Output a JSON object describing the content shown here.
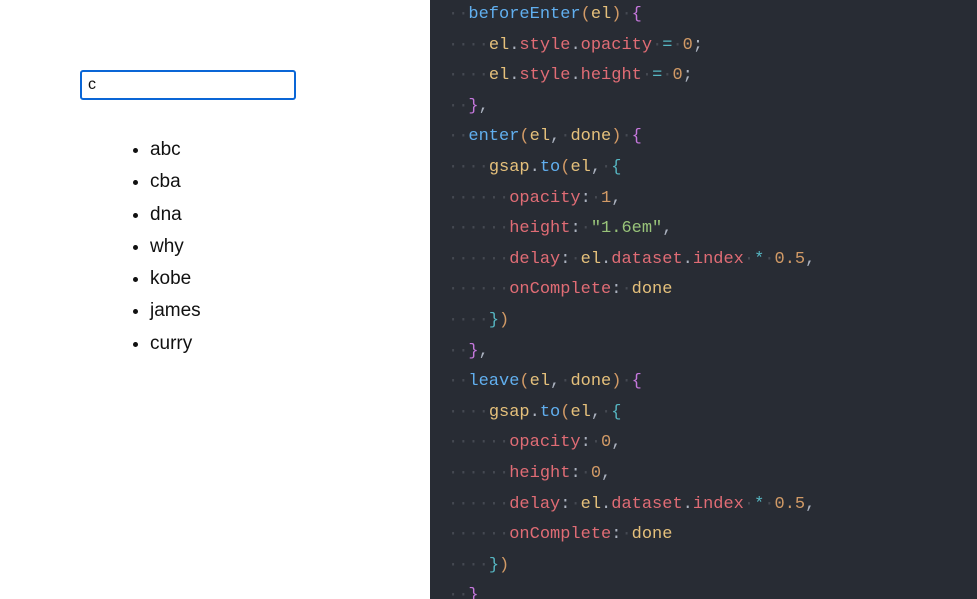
{
  "input": {
    "value": "c",
    "placeholder": ""
  },
  "list": {
    "items": [
      "abc",
      "cba",
      "dna",
      "why",
      "kobe",
      "james",
      "curry"
    ]
  },
  "code": {
    "tokens": [
      [
        [
          "  ",
          "ws"
        ],
        [
          "beforeEnter",
          "fn"
        ],
        [
          "(",
          "par"
        ],
        [
          "el",
          "name"
        ],
        [
          ")",
          "par"
        ],
        [
          " ",
          "ws"
        ],
        [
          "{",
          "brkt"
        ]
      ],
      [
        [
          "    ",
          "ws"
        ],
        [
          "el",
          "name"
        ],
        [
          ".",
          "pun"
        ],
        [
          "style",
          "prop"
        ],
        [
          ".",
          "pun"
        ],
        [
          "opacity",
          "prop"
        ],
        [
          " ",
          "ws"
        ],
        [
          "=",
          "op"
        ],
        [
          " ",
          "ws"
        ],
        [
          "0",
          "num"
        ],
        [
          ";",
          "pun"
        ]
      ],
      [
        [
          "    ",
          "ws"
        ],
        [
          "el",
          "name"
        ],
        [
          ".",
          "pun"
        ],
        [
          "style",
          "prop"
        ],
        [
          ".",
          "pun"
        ],
        [
          "height",
          "prop"
        ],
        [
          " ",
          "ws"
        ],
        [
          "=",
          "op"
        ],
        [
          " ",
          "ws"
        ],
        [
          "0",
          "num"
        ],
        [
          ";",
          "pun"
        ]
      ],
      [
        [
          "  ",
          "ws"
        ],
        [
          "}",
          "brkt"
        ],
        [
          ",",
          "pun"
        ]
      ],
      [
        [
          "  ",
          "ws"
        ],
        [
          "enter",
          "fn"
        ],
        [
          "(",
          "par"
        ],
        [
          "el",
          "name"
        ],
        [
          ",",
          "pun"
        ],
        [
          " ",
          "ws"
        ],
        [
          "done",
          "name"
        ],
        [
          ")",
          "par"
        ],
        [
          " ",
          "ws"
        ],
        [
          "{",
          "brkt"
        ]
      ],
      [
        [
          "    ",
          "ws"
        ],
        [
          "gsap",
          "name"
        ],
        [
          ".",
          "pun"
        ],
        [
          "to",
          "fn"
        ],
        [
          "(",
          "par"
        ],
        [
          "el",
          "name"
        ],
        [
          ",",
          "pun"
        ],
        [
          " ",
          "ws"
        ],
        [
          "{",
          "par2"
        ]
      ],
      [
        [
          "      ",
          "ws"
        ],
        [
          "opacity",
          "prop"
        ],
        [
          ":",
          "pun"
        ],
        [
          " ",
          "ws"
        ],
        [
          "1",
          "num"
        ],
        [
          ",",
          "pun"
        ]
      ],
      [
        [
          "      ",
          "ws"
        ],
        [
          "height",
          "prop"
        ],
        [
          ":",
          "pun"
        ],
        [
          " ",
          "ws"
        ],
        [
          "\"1.6em\"",
          "str"
        ],
        [
          ",",
          "pun"
        ]
      ],
      [
        [
          "      ",
          "ws"
        ],
        [
          "delay",
          "prop"
        ],
        [
          ":",
          "pun"
        ],
        [
          " ",
          "ws"
        ],
        [
          "el",
          "name"
        ],
        [
          ".",
          "pun"
        ],
        [
          "dataset",
          "prop"
        ],
        [
          ".",
          "pun"
        ],
        [
          "index",
          "prop"
        ],
        [
          " ",
          "ws"
        ],
        [
          "*",
          "op"
        ],
        [
          " ",
          "ws"
        ],
        [
          "0.5",
          "num"
        ],
        [
          ",",
          "pun"
        ]
      ],
      [
        [
          "      ",
          "ws"
        ],
        [
          "onComplete",
          "prop"
        ],
        [
          ":",
          "pun"
        ],
        [
          " ",
          "ws"
        ],
        [
          "done",
          "name"
        ]
      ],
      [
        [
          "    ",
          "ws"
        ],
        [
          "}",
          "par2"
        ],
        [
          ")",
          "par"
        ]
      ],
      [
        [
          "  ",
          "ws"
        ],
        [
          "}",
          "brkt"
        ],
        [
          ",",
          "pun"
        ]
      ],
      [
        [
          "  ",
          "ws"
        ],
        [
          "leave",
          "fn"
        ],
        [
          "(",
          "par"
        ],
        [
          "el",
          "name"
        ],
        [
          ",",
          "pun"
        ],
        [
          " ",
          "ws"
        ],
        [
          "done",
          "name"
        ],
        [
          ")",
          "par"
        ],
        [
          " ",
          "ws"
        ],
        [
          "{",
          "brkt"
        ]
      ],
      [
        [
          "    ",
          "ws"
        ],
        [
          "gsap",
          "name"
        ],
        [
          ".",
          "pun"
        ],
        [
          "to",
          "fn"
        ],
        [
          "(",
          "par"
        ],
        [
          "el",
          "name"
        ],
        [
          ",",
          "pun"
        ],
        [
          " ",
          "ws"
        ],
        [
          "{",
          "par2"
        ]
      ],
      [
        [
          "      ",
          "ws"
        ],
        [
          "opacity",
          "prop"
        ],
        [
          ":",
          "pun"
        ],
        [
          " ",
          "ws"
        ],
        [
          "0",
          "num"
        ],
        [
          ",",
          "pun"
        ]
      ],
      [
        [
          "      ",
          "ws"
        ],
        [
          "height",
          "prop"
        ],
        [
          ":",
          "pun"
        ],
        [
          " ",
          "ws"
        ],
        [
          "0",
          "num"
        ],
        [
          ",",
          "pun"
        ]
      ],
      [
        [
          "      ",
          "ws"
        ],
        [
          "delay",
          "prop"
        ],
        [
          ":",
          "pun"
        ],
        [
          " ",
          "ws"
        ],
        [
          "el",
          "name"
        ],
        [
          ".",
          "pun"
        ],
        [
          "dataset",
          "prop"
        ],
        [
          ".",
          "pun"
        ],
        [
          "index",
          "prop"
        ],
        [
          " ",
          "ws"
        ],
        [
          "*",
          "op"
        ],
        [
          " ",
          "ws"
        ],
        [
          "0.5",
          "num"
        ],
        [
          ",",
          "pun"
        ]
      ],
      [
        [
          "      ",
          "ws"
        ],
        [
          "onComplete",
          "prop"
        ],
        [
          ":",
          "pun"
        ],
        [
          " ",
          "ws"
        ],
        [
          "done",
          "name"
        ]
      ],
      [
        [
          "    ",
          "ws"
        ],
        [
          "}",
          "par2"
        ],
        [
          ")",
          "par"
        ]
      ],
      [
        [
          "  ",
          "ws"
        ],
        [
          "}",
          "brkt"
        ]
      ]
    ]
  }
}
